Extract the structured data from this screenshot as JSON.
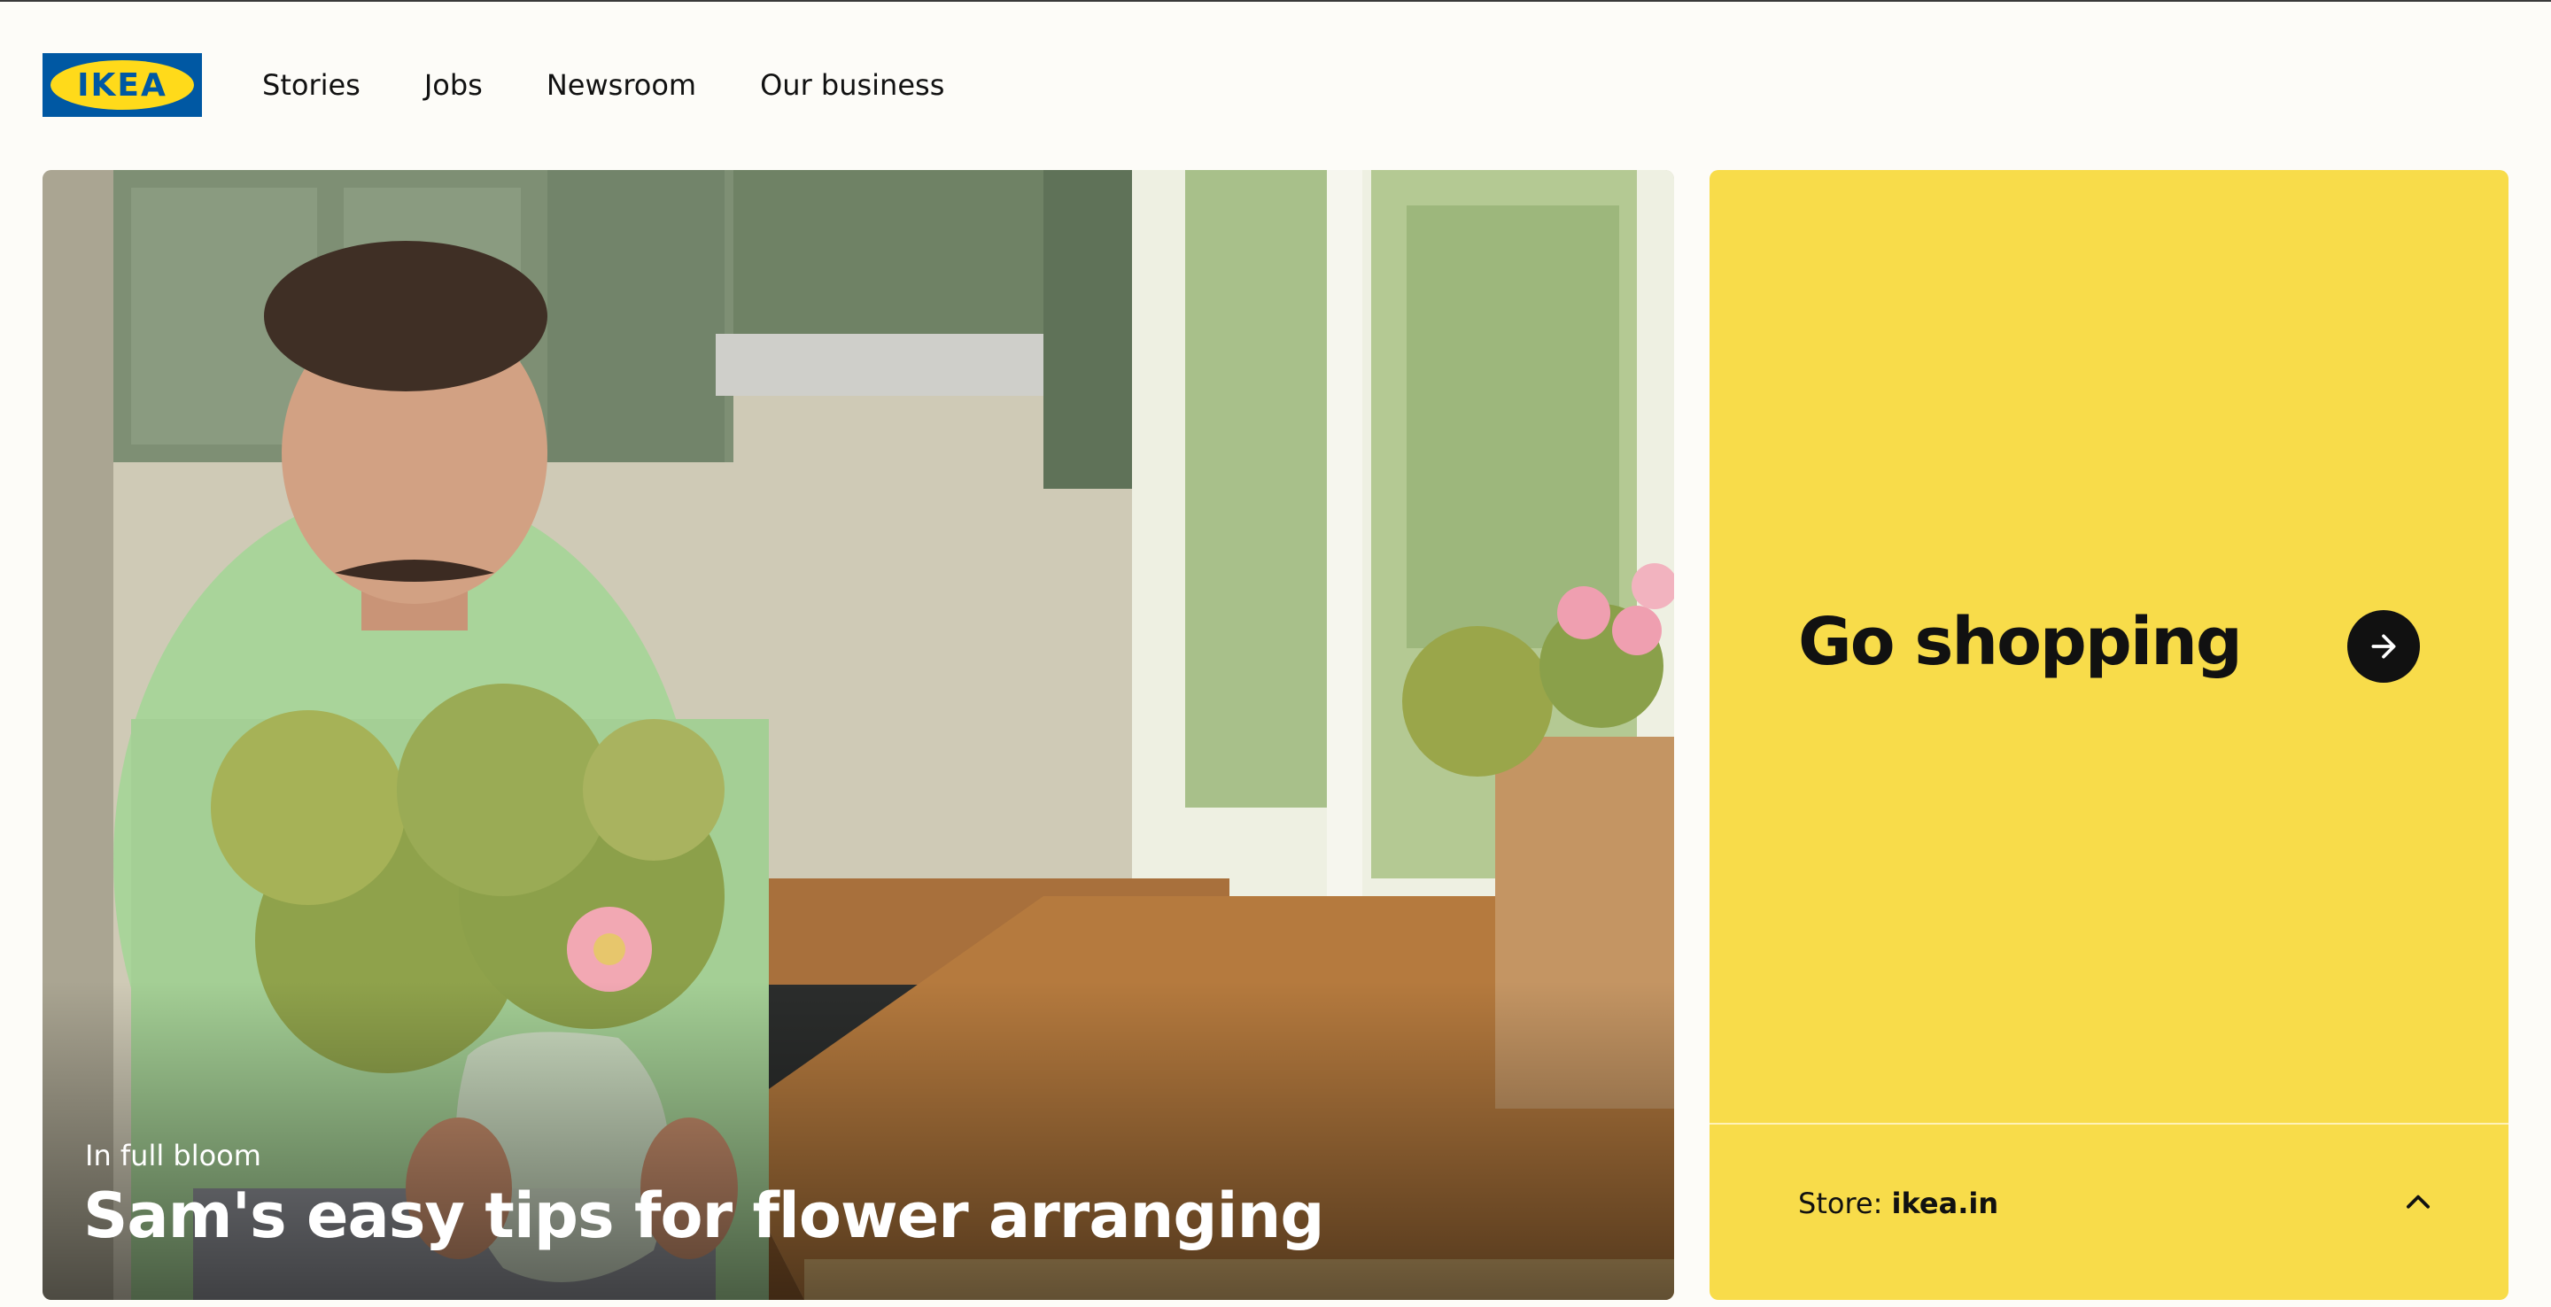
{
  "header": {
    "logo_text": "IKEA",
    "nav": [
      "Stories",
      "Jobs",
      "Newsroom",
      "Our business"
    ]
  },
  "hero": {
    "kicker": "In full bloom",
    "title": "Sam's easy tips for flower arranging"
  },
  "shop_panel": {
    "title": "Go shopping",
    "arrow_icon": "arrow-right-icon",
    "store_label": "Store: ",
    "store_value": "ikea.in",
    "toggle_icon": "chevron-up-icon"
  },
  "colors": {
    "brand_blue": "#0058a3",
    "brand_yellow": "#ffda1a",
    "panel_yellow": "#f8dc4a",
    "page_bg": "#fdfcf8"
  }
}
